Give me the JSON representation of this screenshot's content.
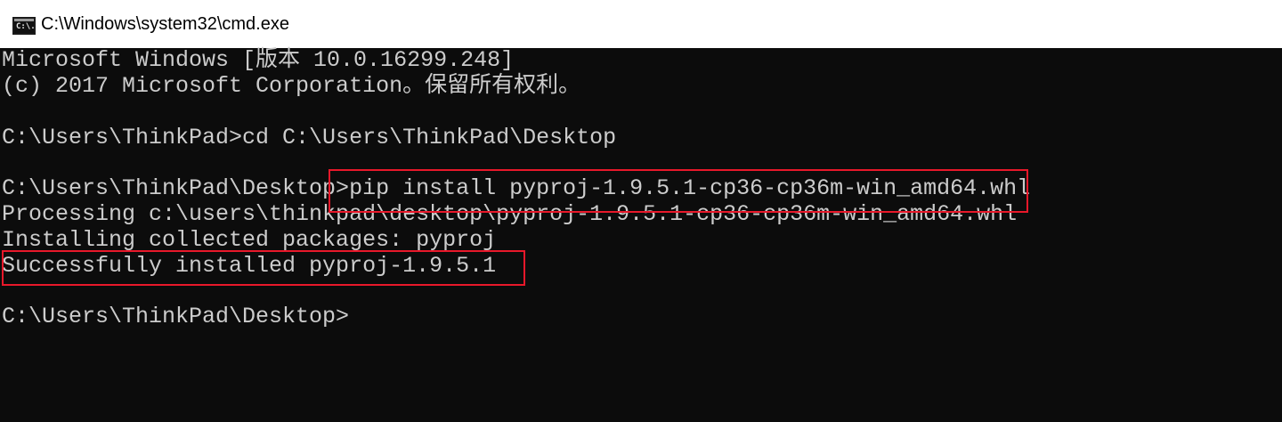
{
  "window": {
    "title": "C:\\Windows\\system32\\cmd.exe",
    "icon": "cmd-icon",
    "icon_label": "C:\\."
  },
  "console": {
    "lines": [
      "Microsoft Windows [版本 10.0.16299.248]",
      "(c) 2017 Microsoft Corporation。保留所有权利。",
      "",
      "C:\\Users\\ThinkPad>cd C:\\Users\\ThinkPad\\Desktop",
      "",
      "C:\\Users\\ThinkPad\\Desktop>pip install pyproj-1.9.5.1-cp36-cp36m-win_amd64.whl",
      "Processing c:\\users\\thinkpad\\desktop\\pyproj-1.9.5.1-cp36-cp36m-win_amd64.whl",
      "Installing collected packages: pyproj",
      "Successfully installed pyproj-1.9.5.1",
      "",
      "C:\\Users\\ThinkPad\\Desktop>"
    ]
  },
  "colors": {
    "console_background": "#0c0c0c",
    "console_text": "#cccccc",
    "highlight_box": "#e8182a",
    "titlebar_background": "#ffffff"
  }
}
